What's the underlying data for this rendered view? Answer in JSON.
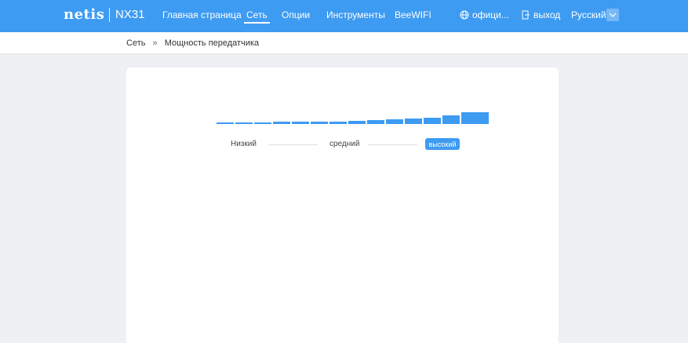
{
  "header": {
    "brand": "netis",
    "model": "NX31",
    "nav": [
      {
        "label": "Главная страница"
      },
      {
        "label": "Сеть",
        "active": true
      },
      {
        "label": "Опции"
      },
      {
        "label": "Инструменты"
      },
      {
        "label": "BeeWIFI"
      }
    ],
    "official_label": "офици...",
    "logout_label": "выход",
    "language": "Русский"
  },
  "breadcrumb": {
    "parent": "Сеть",
    "separator": "»",
    "current": "Мощность передатчика"
  },
  "power": {
    "levels": [
      "Низкий",
      "средний",
      "высокий"
    ],
    "selected": "высокий",
    "bar_count": 14,
    "accent": "#3d9bf2"
  },
  "colors": {
    "header_bg": "#3d9bf2",
    "page_bg": "#eef0f3"
  }
}
